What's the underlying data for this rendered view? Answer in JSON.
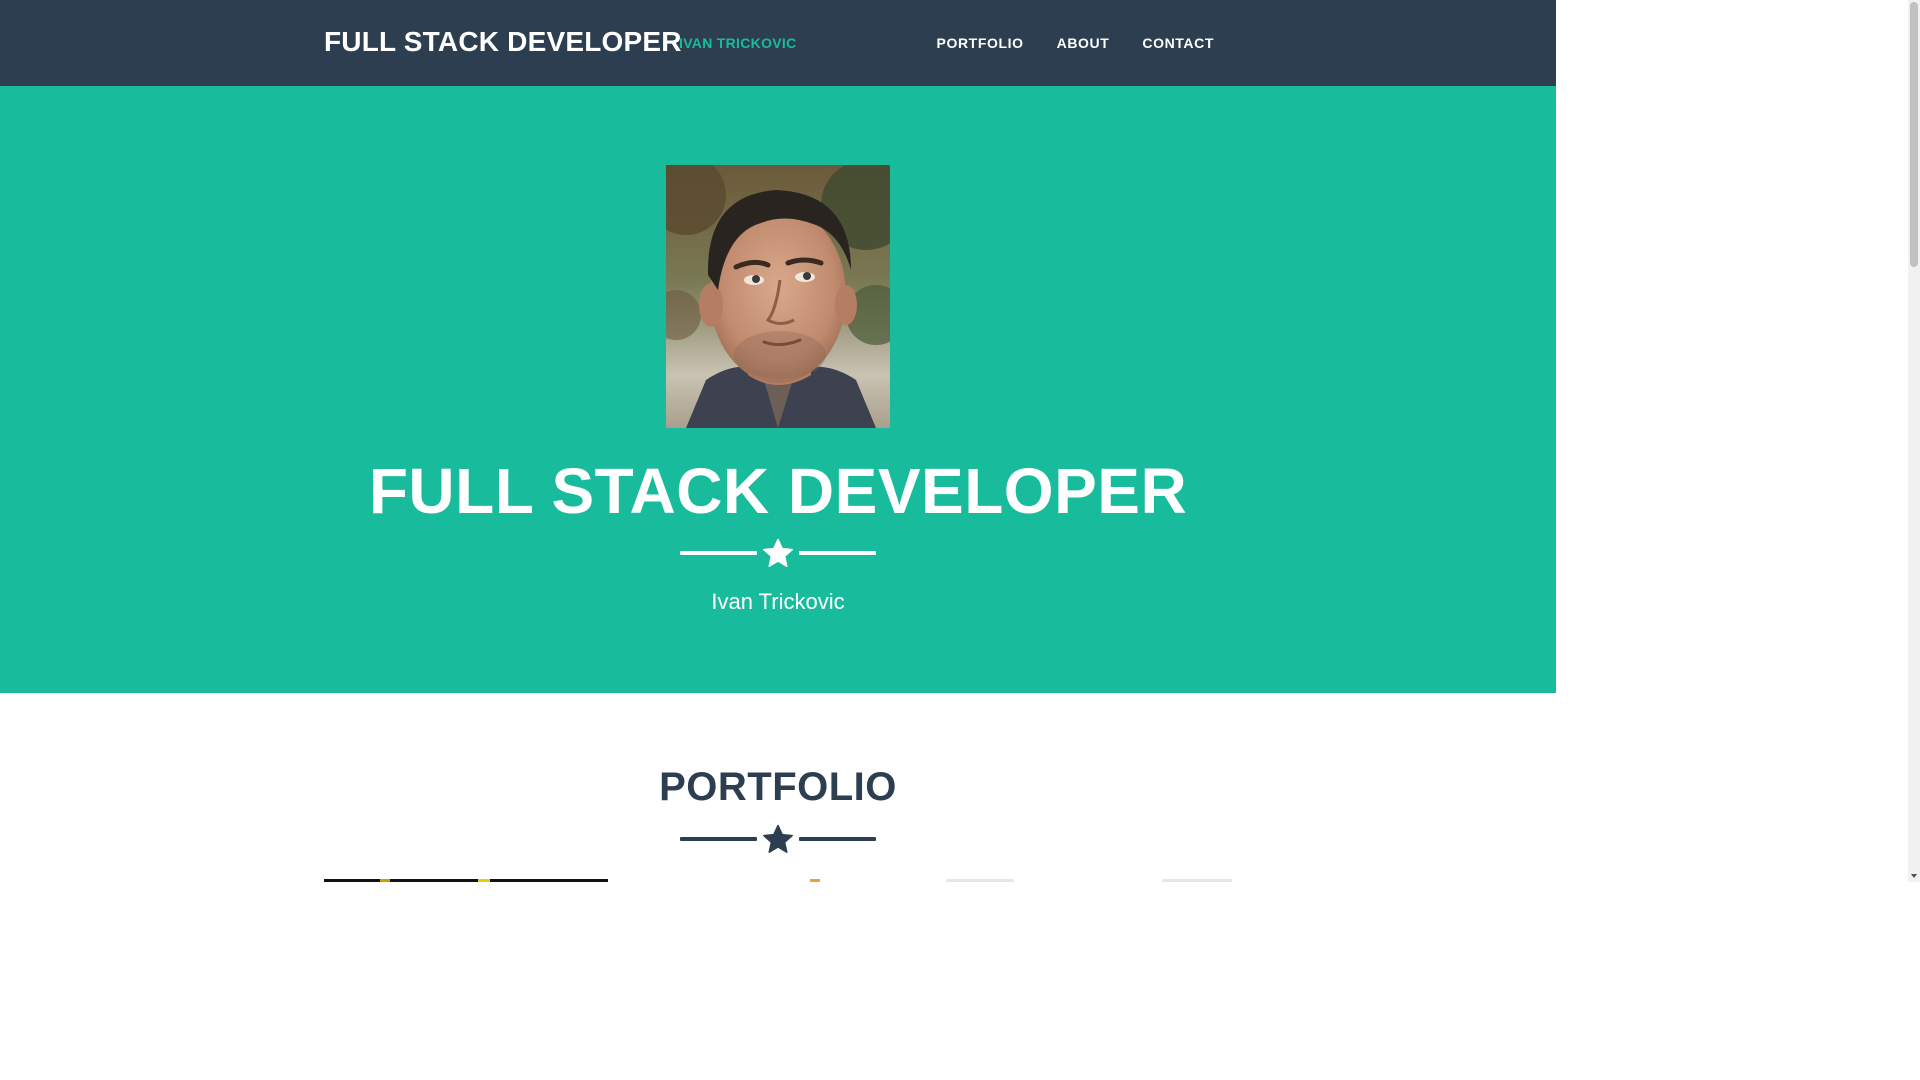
{
  "nav": {
    "brand": "FULL STACK DEVELOPER",
    "brand_sub": "IVAN TRICKOVIC",
    "links": [
      "PORTFOLIO",
      "ABOUT",
      "CONTACT"
    ]
  },
  "hero": {
    "title": "FULL STACK DEVELOPER",
    "subtitle": "Ivan Trickovic",
    "divider_icon": "star-icon"
  },
  "portfolio": {
    "title": "PORTFOLIO",
    "divider_icon": "star-icon"
  },
  "colors": {
    "navbar": "#2c3e50",
    "hero": "#18bc9c",
    "accent": "#18bc9c",
    "dark": "#2c3e50",
    "white": "#ffffff"
  }
}
